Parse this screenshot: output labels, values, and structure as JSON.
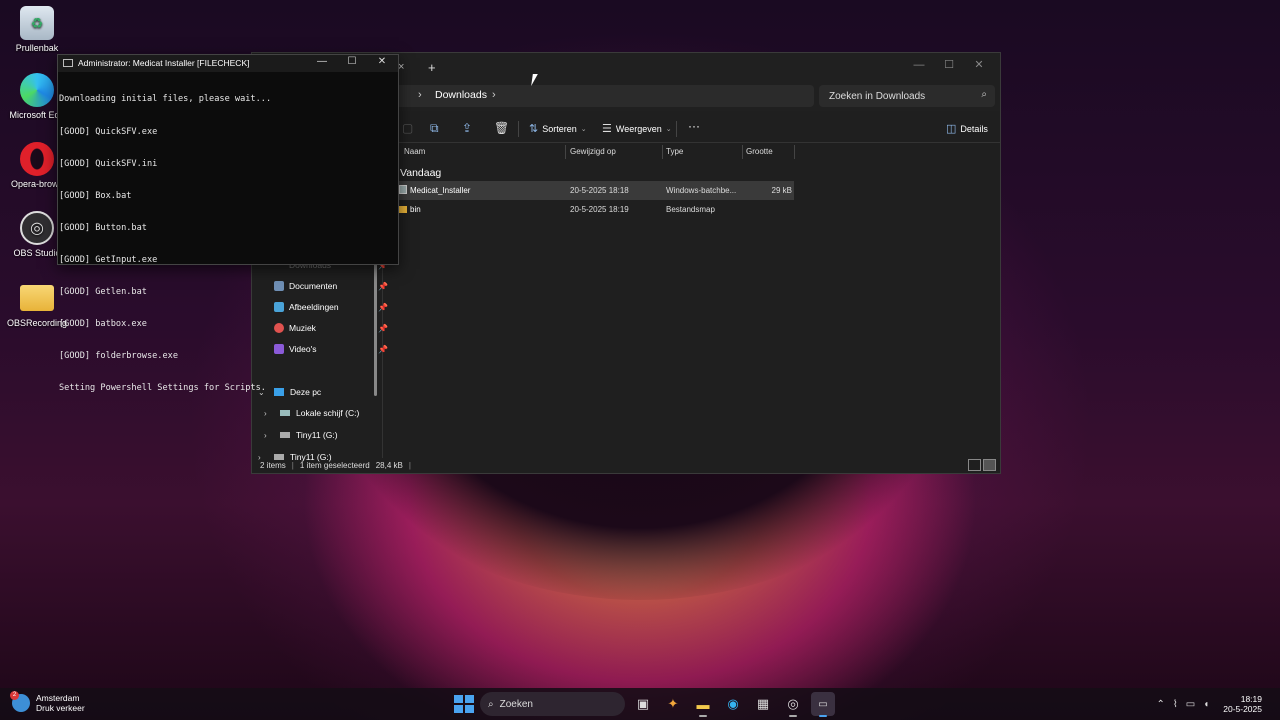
{
  "desktop": {
    "icons": [
      {
        "label": "Prullenbak",
        "icon": "recycle-bin-icon"
      },
      {
        "label": "Microsoft Edg",
        "icon": "edge-icon"
      },
      {
        "label": "Opera-brows",
        "icon": "opera-icon"
      },
      {
        "label": "OBS Studio",
        "icon": "obs-icon"
      },
      {
        "label": "OBSRecording",
        "icon": "folder-icon"
      }
    ]
  },
  "console": {
    "title": "Administrator: Medicat Installer [FILECHECK]",
    "lines": [
      "Downloading initial files, please wait...",
      "[GOOD] QuickSFV.exe",
      "[GOOD] QuickSFV.ini",
      "[GOOD] Box.bat",
      "[GOOD] Button.bat",
      "[GOOD] GetInput.exe",
      "[GOOD] Getlen.bat",
      "[GOOD] batbox.exe",
      "[GOOD] folderbrowse.exe",
      "Setting Powershell Settings for Scripts."
    ]
  },
  "explorer": {
    "tab_add": "+",
    "tab_close": "×",
    "address": {
      "crumb": "Downloads",
      "chevron": "›"
    },
    "search": {
      "placeholder": "Zoeken in Downloads"
    },
    "toolbar": {
      "sort_label": "Sorteren",
      "view_label": "Weergeven",
      "more_label": "···",
      "details_label": "Details"
    },
    "sidebar": {
      "partial_label": "Downloads",
      "items": [
        {
          "label": "Documenten",
          "color": "#6f8fb5"
        },
        {
          "label": "Afbeeldingen",
          "color": "#4aa3d8"
        },
        {
          "label": "Muziek",
          "color": "#e0524f"
        },
        {
          "label": "Video's",
          "color": "#8a5ad8"
        }
      ],
      "tree": [
        {
          "label": "Deze pc",
          "arrow": "⌄"
        },
        {
          "label": "Lokale schijf (C:)",
          "arrow": "›"
        },
        {
          "label": "Tiny11 (G:)",
          "arrow": "›"
        },
        {
          "label": "Tiny11 (G:)",
          "arrow": "›"
        }
      ]
    },
    "columns": {
      "name": "Naam",
      "modified": "Gewijzigd op",
      "type": "Type",
      "size": "Grootte"
    },
    "group": "Vandaag",
    "files": [
      {
        "name": "Medicat_Installer",
        "modified": "20-5-2025 18:18",
        "type": "Windows-batchbe...",
        "size": "29 kB",
        "selected": true,
        "icon": "batch-file-icon"
      },
      {
        "name": "bin",
        "modified": "20-5-2025 18:19",
        "type": "Bestandsmap",
        "size": "",
        "selected": false,
        "icon": "folder-icon"
      }
    ],
    "status": {
      "items": "2 items",
      "selection": "1 item geselecteerd",
      "size": "28,4 kB"
    }
  },
  "taskbar": {
    "weather_city": "Amsterdam",
    "weather_status": "Druk verkeer",
    "weather_badge": "2",
    "search_label": "Zoeken",
    "time": "18:19",
    "date": "20-5-2025"
  }
}
